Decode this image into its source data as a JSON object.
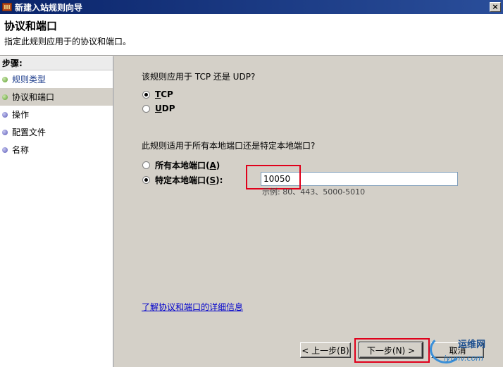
{
  "window": {
    "title": "新建入站规则向导",
    "close_glyph": "×"
  },
  "header": {
    "title": "协议和端口",
    "subtitle": "指定此规则应用于的协议和端口。"
  },
  "steps": {
    "title": "步骤:",
    "items": [
      {
        "label": "规则类型",
        "state": "done"
      },
      {
        "label": "协议和端口",
        "state": "current"
      },
      {
        "label": "操作",
        "state": "pending"
      },
      {
        "label": "配置文件",
        "state": "pending"
      },
      {
        "label": "名称",
        "state": "pending"
      }
    ]
  },
  "protocol": {
    "question": "该规则应用于 TCP 还是 UDP?",
    "tcp": {
      "label": "TCP",
      "underline": "T",
      "rest": "CP",
      "checked": true
    },
    "udp": {
      "label": "UDP",
      "underline": "U",
      "rest": "DP",
      "checked": false
    }
  },
  "ports": {
    "question": "此规则适用于所有本地端口还是特定本地端口?",
    "all": {
      "label": "所有本地端口(A)",
      "text": "所有本地端口(",
      "key": "A",
      "close": ")",
      "checked": false
    },
    "specific": {
      "label": "特定本地端口(S):",
      "text": "特定本地端口(",
      "key": "S",
      "close": "):",
      "checked": true
    },
    "value": "10050",
    "example": "示例: 80、443、5000-5010"
  },
  "link": "了解协议和端口的详细信息",
  "buttons": {
    "back": "< 上一步(B)",
    "next": "下一步(N) >",
    "cancel": "取消"
  },
  "watermark": {
    "text": "运维网",
    "url": "iyunv.com"
  },
  "colors": {
    "titlebar": "#0a246a",
    "highlight": "#e0001b",
    "link": "#0000cc"
  }
}
